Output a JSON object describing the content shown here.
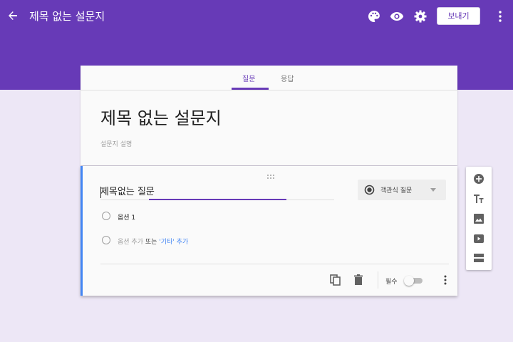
{
  "header": {
    "title": "제목 없는 설문지",
    "send_label": "보내기",
    "icons": [
      "back-arrow-icon",
      "palette-icon",
      "eye-icon",
      "gear-icon",
      "more-vert-icon"
    ]
  },
  "tabs": [
    {
      "label": "질문",
      "active": true
    },
    {
      "label": "응답",
      "active": false
    }
  ],
  "form": {
    "title": "제목 없는 설문지",
    "description_placeholder": "설문지 설명"
  },
  "question": {
    "title": "제목없는 질문",
    "type_label": "객관식 질문",
    "options": [
      {
        "label": "옵션 1"
      }
    ],
    "add_option": {
      "prefix": "옵션 추가",
      "or": "또는",
      "etc": "'기타' 추가"
    },
    "required_label": "필수",
    "required": false
  },
  "colors": {
    "accent": "#673ab7",
    "background": "#ede7f6",
    "card": "#fafafa",
    "focus_border": "#4285f4"
  },
  "side_toolbar": {
    "icons": [
      "add-circle-icon",
      "title-tt-icon",
      "image-icon",
      "video-icon",
      "section-icon"
    ]
  }
}
